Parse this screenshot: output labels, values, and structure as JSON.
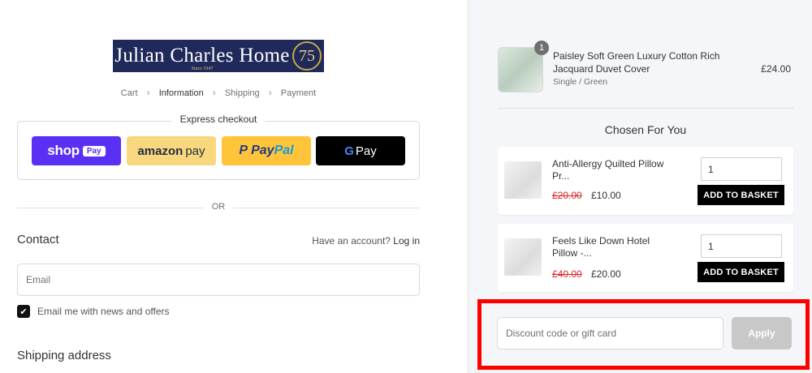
{
  "brand": {
    "name": "Julian Charles Home",
    "since": "Since 1947",
    "badge": "75"
  },
  "breadcrumb": [
    "Cart",
    "Information",
    "Shipping",
    "Payment"
  ],
  "express": {
    "title": "Express checkout",
    "shop": {
      "word": "shop",
      "pay": "Pay"
    },
    "amazon": {
      "word": "amazon",
      "pay": "pay"
    },
    "paypal": {
      "p": "P",
      "pay": "Pay",
      "pal": "Pal"
    },
    "gpay": {
      "g": "G",
      "pay": "Pay"
    }
  },
  "divider_or": "OR",
  "contact": {
    "heading": "Contact",
    "have_account": "Have an account?",
    "login": "Log in",
    "email_placeholder": "Email",
    "newsletter_label": "Email me with news and offers",
    "newsletter_checked": true
  },
  "shipping_heading": "Shipping address",
  "order": {
    "quantity": "1",
    "name": "Paisley Soft Green Luxury Cotton Rich Jacquard Duvet Cover",
    "variant": "Single / Green",
    "price": "£24.00"
  },
  "chosen": {
    "heading": "Chosen For You",
    "items": [
      {
        "name": "Anti-Allergy Quilted Pillow Pr...",
        "old_price": "£20.00",
        "price": "£10.00",
        "qty": "1",
        "button": "ADD TO BASKET"
      },
      {
        "name": "Feels Like Down Hotel Pillow -...",
        "old_price": "£40.00",
        "price": "£20.00",
        "qty": "1",
        "button": "ADD TO BASKET"
      }
    ]
  },
  "discount": {
    "placeholder": "Discount code or gift card",
    "apply": "Apply"
  },
  "colors": {
    "highlight": "#ff0000",
    "shop_pay": "#5a31f4",
    "paypal": "#ffc439",
    "amazon": "#f9d77e"
  }
}
